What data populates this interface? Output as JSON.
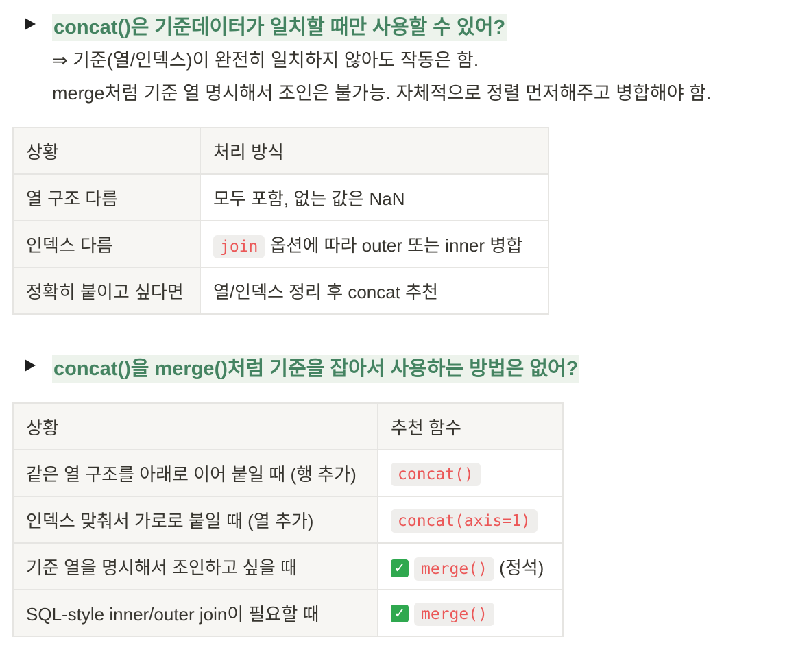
{
  "toggle1": {
    "question": "concat()은 기준데이터가 일치할 때만 사용할 수 있어?",
    "answer_line1": "⇒ 기준(열/인덱스)이 완전히 일치하지 않아도 작동은 함.",
    "answer_line2": "merge처럼 기준 열 명시해서 조인은 불가능. 자체적으로 정렬 먼저해주고 병합해야 함."
  },
  "table1": {
    "headers": [
      "상황",
      "처리 방식"
    ],
    "rows": [
      {
        "situation": "열 구조 다름",
        "method": "모두 포함, 없는 값은 NaN"
      },
      {
        "situation": "인덱스 다름",
        "method_code": "join",
        "method": "옵션에 따라 outer 또는 inner 병합"
      },
      {
        "situation": "정확히 붙이고 싶다면",
        "method": "열/인덱스 정리 후 concat 추천"
      }
    ]
  },
  "toggle2": {
    "question": "concat()을 merge()처럼 기준을 잡아서 사용하는 방법은 없어?"
  },
  "table2": {
    "headers": [
      "상황",
      "추천 함수"
    ],
    "rows": [
      {
        "situation": "같은 열 구조를 아래로 이어 붙일 때 (행 추가)",
        "func": "concat()"
      },
      {
        "situation": "인덱스 맞춰서 가로로 붙일 때 (열 추가)",
        "func": "concat(axis=1)"
      },
      {
        "situation": "기준 열을 명시해서 조인하고 싶을 때",
        "func": "merge()",
        "note": "(정석)"
      },
      {
        "situation": "SQL-style inner/outer join이 필요할 때",
        "func": "merge()"
      }
    ]
  },
  "icons": {
    "toggle_arrow": "triangle-right",
    "check": "white-check-mark",
    "check_color": "#2fa84f"
  },
  "colors": {
    "question_text": "#448361",
    "question_bg": "#edf3ec",
    "code_text": "#eb5757"
  }
}
